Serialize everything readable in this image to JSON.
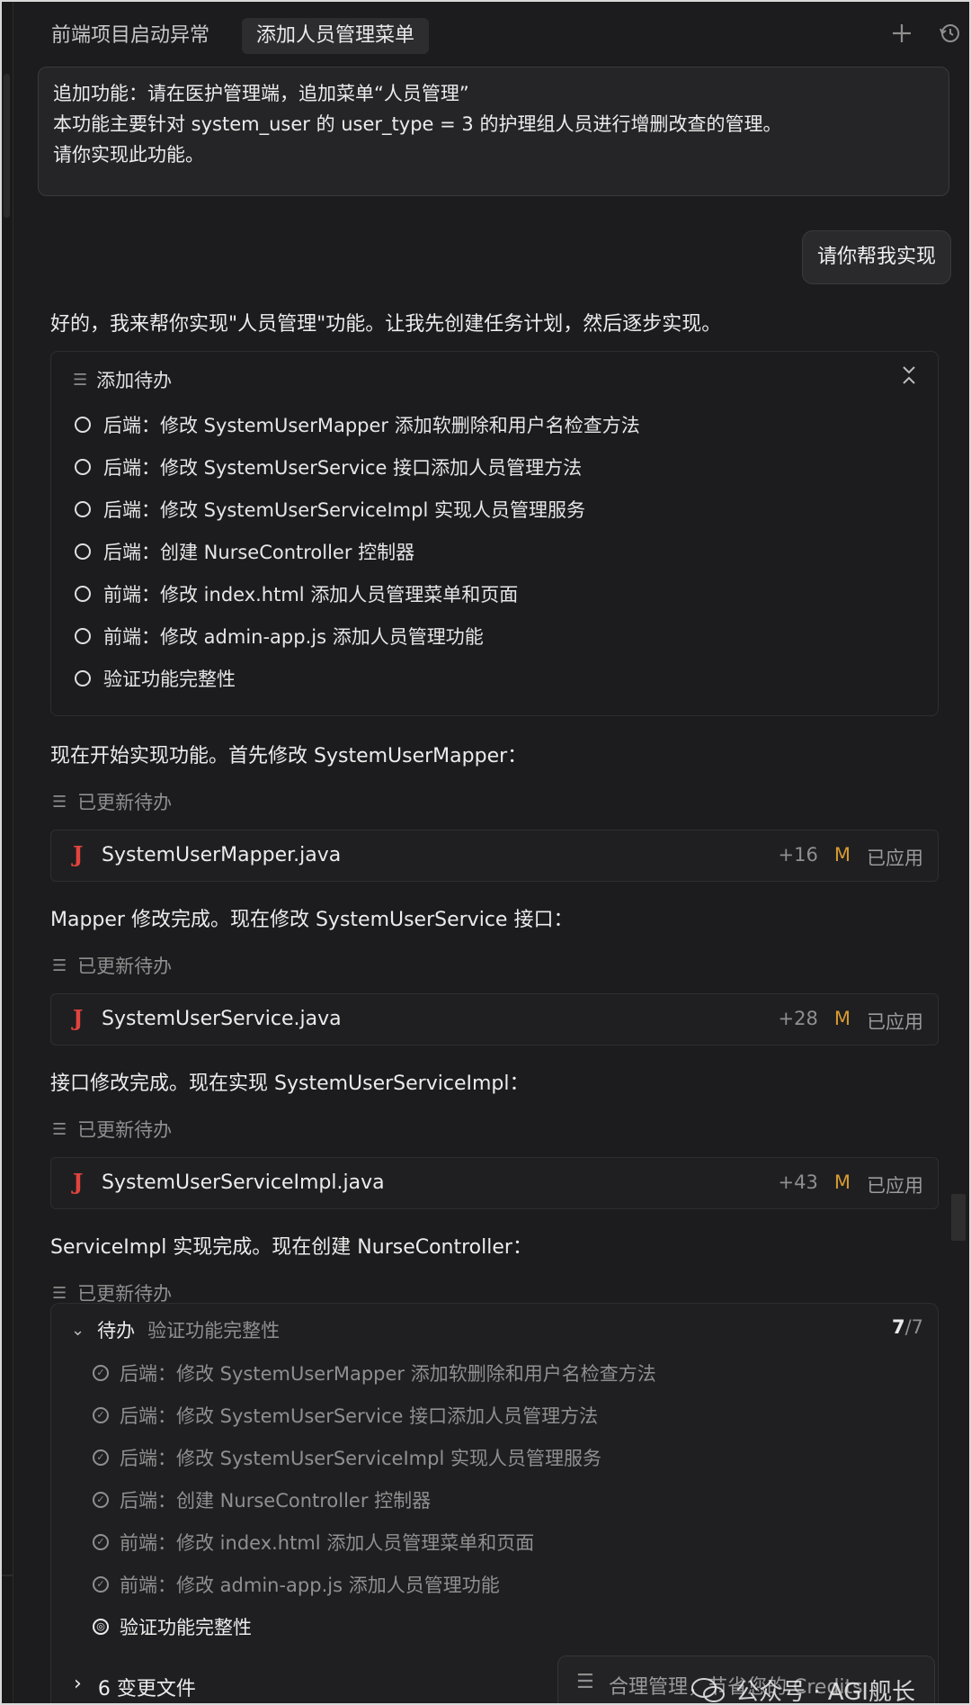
{
  "tabs": [
    {
      "label": "前端项目启动异常"
    },
    {
      "label": "添加人员管理菜单"
    }
  ],
  "request": {
    "lines": [
      "追加功能：请在医护管理端，追加菜单“人员管理”",
      "本功能主要针对 system_user 的 user_type = 3 的护理组人员进行增删改查的管理。",
      "请你实现此功能。"
    ]
  },
  "user_bubble": "请你帮我实现",
  "reply_intro": "好的，我来帮你实现\"人员管理\"功能。让我先创建任务计划，然后逐步实现。",
  "todo_card": {
    "title": "添加待办",
    "items": [
      "后端：修改 SystemUserMapper 添加软删除和用户名检查方法",
      "后端：修改 SystemUserService 接口添加人员管理方法",
      "后端：修改 SystemUserServiceImpl 实现人员管理服务",
      "后端：创建 NurseController 控制器",
      "前端：修改 index.html 添加人员管理菜单和页面",
      "前端：修改 admin-app.js 添加人员管理功能",
      "验证功能完整性"
    ]
  },
  "steps": [
    {
      "text": "现在开始实现功能。首先修改 SystemUserMapper：",
      "updated": "已更新待办",
      "file": "SystemUserMapper.java",
      "added": "+16",
      "mark": "M",
      "status": "已应用"
    },
    {
      "text": "Mapper 修改完成。现在修改 SystemUserService 接口：",
      "updated": "已更新待办",
      "file": "SystemUserService.java",
      "added": "+28",
      "mark": "M",
      "status": "已应用"
    },
    {
      "text": "接口修改完成。现在实现 SystemUserServiceImpl：",
      "updated": "已更新待办",
      "file": "SystemUserServiceImpl.java",
      "added": "+43",
      "mark": "M",
      "status": "已应用"
    },
    {
      "text": "ServiceImpl 实现完成。现在创建 NurseController：",
      "updated": "已更新待办"
    }
  ],
  "todo_panel": {
    "label": "待办",
    "current": "验证功能完整性",
    "done": "7",
    "total": "/7",
    "items": [
      "后端：修改 SystemUserMapper 添加软删除和用户名检查方法",
      "后端：修改 SystemUserService 接口添加人员管理方法",
      "后端：修改 SystemUserServiceImpl 实现人员管理服务",
      "后端：创建 NurseController 控制器",
      "前端：修改 index.html 添加人员管理菜单和页面",
      "前端：修改 admin-app.js 添加人员管理功能",
      "验证功能完整性"
    ]
  },
  "changed_files": {
    "count": "6",
    "label": "变更文件"
  },
  "credits_button": "合理管理，节省您的 Credits",
  "watermark": "公众号 · AGI舰长",
  "colors": {
    "background": "#1c1c1e",
    "modified": "#d89a32",
    "java_icon": "#e0443e"
  }
}
